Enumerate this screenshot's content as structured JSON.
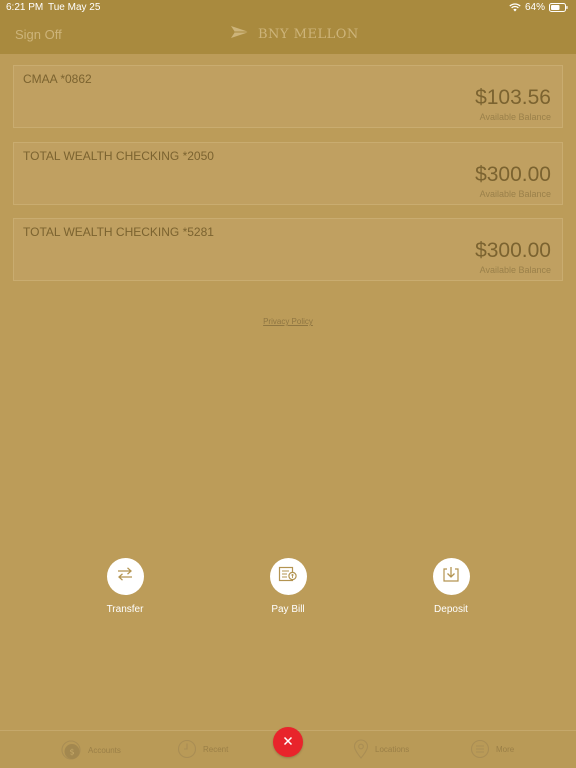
{
  "status_bar": {
    "time": "6:21 PM",
    "date": "Tue May 25",
    "battery": "64%",
    "icons": [
      "wifi-icon",
      "battery-icon"
    ]
  },
  "header": {
    "sign_off": "Sign Off",
    "logo_text": "BNY MELLON",
    "logo_icon": "arrow-logo-icon"
  },
  "accounts": [
    {
      "name": "CMAA *0862",
      "balance": "$103.56",
      "balance_label": "Available Balance"
    },
    {
      "name": "TOTAL WEALTH CHECKING *2050",
      "balance": "$300.00",
      "balance_label": "Available Balance"
    },
    {
      "name": "TOTAL WEALTH CHECKING *5281",
      "balance": "$300.00",
      "balance_label": "Available Balance"
    }
  ],
  "privacy_policy": "Privacy Policy",
  "actions": [
    {
      "label": "Transfer",
      "icon": "transfer-icon"
    },
    {
      "label": "Pay Bill",
      "icon": "pay-bill-icon"
    },
    {
      "label": "Deposit",
      "icon": "deposit-icon"
    }
  ],
  "tabs": [
    {
      "label": "Accounts",
      "icon": "accounts-icon"
    },
    {
      "label": "Recent",
      "icon": "clock-icon"
    },
    {
      "label": "Locations",
      "icon": "location-pin-icon"
    },
    {
      "label": "More",
      "icon": "menu-icon"
    }
  ],
  "fab_icon": "close-icon",
  "colors": {
    "background": "#bc9c59",
    "header": "#a98a3e",
    "fab": "#e8242b",
    "text": "#7b6330"
  }
}
